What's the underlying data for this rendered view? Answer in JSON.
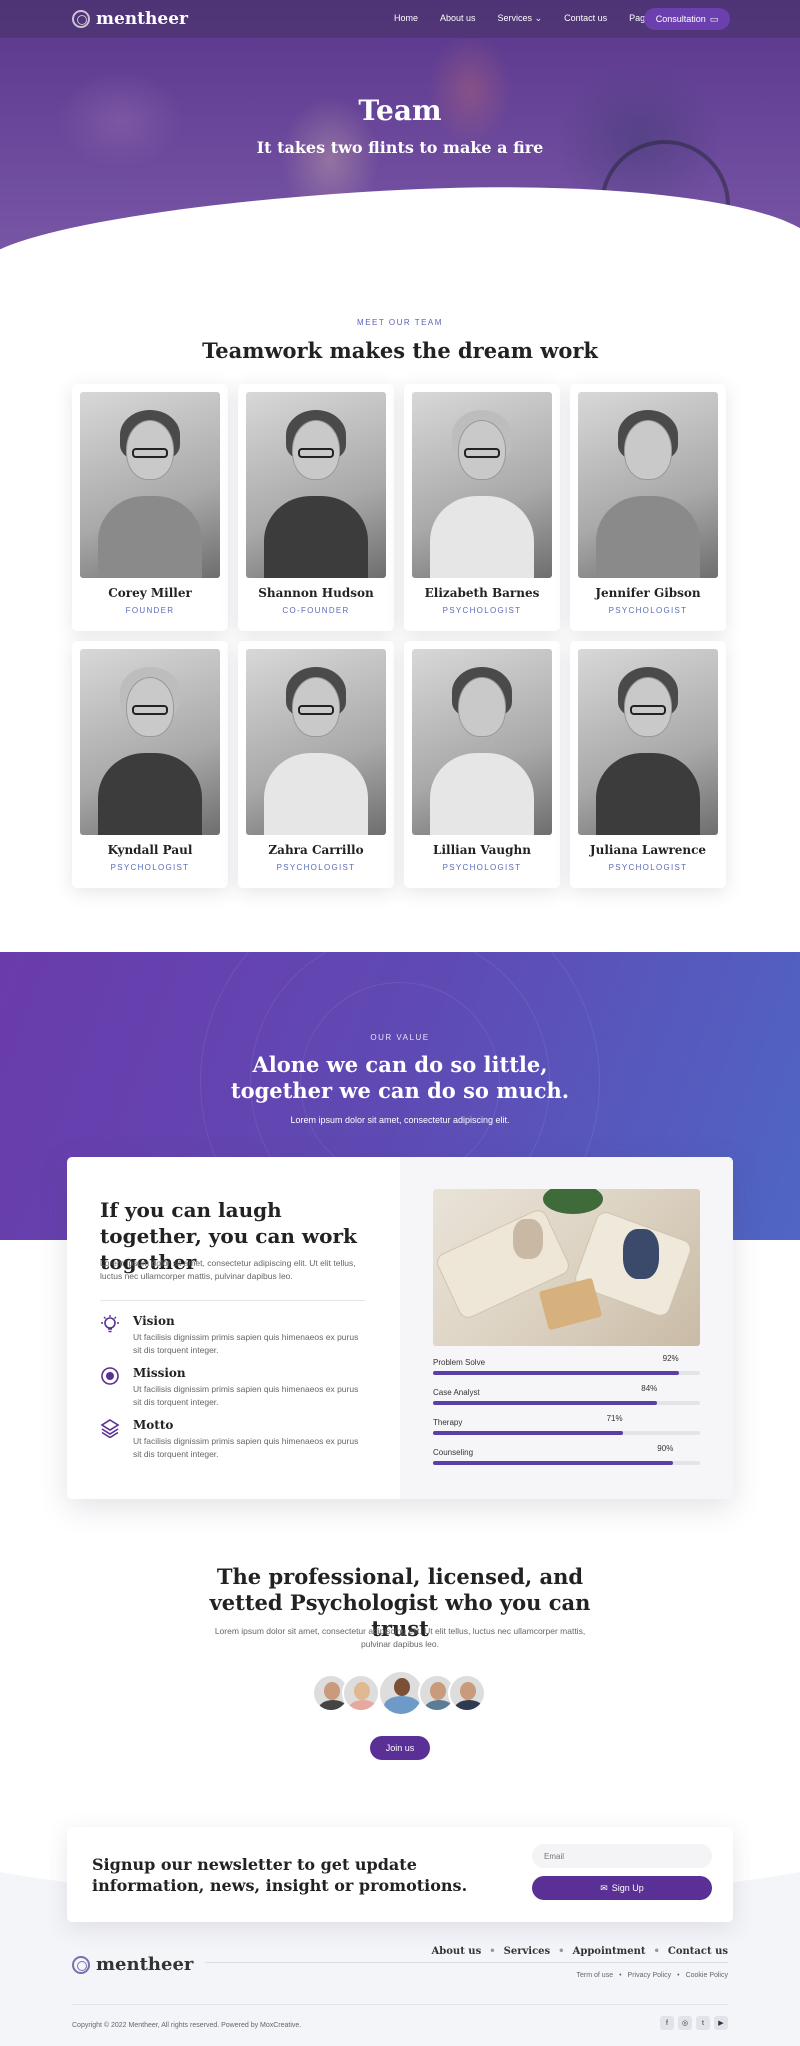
{
  "brand": {
    "name": "mentheer"
  },
  "nav": {
    "links": [
      "Home",
      "About us",
      "Services",
      "Contact us",
      "Pages"
    ],
    "consultation": "Consultation"
  },
  "hero": {
    "title": "Team",
    "subtitle": "It takes two flints to make a fire"
  },
  "team": {
    "eyebrow": "MEET OUR TEAM",
    "title": "Teamwork makes the dream work",
    "members": [
      {
        "name": "Corey Miller",
        "role": "FOUNDER"
      },
      {
        "name": "Shannon Hudson",
        "role": "CO-FOUNDER"
      },
      {
        "name": "Elizabeth Barnes",
        "role": "PSYCHOLOGIST"
      },
      {
        "name": "Jennifer Gibson",
        "role": "PSYCHOLOGIST"
      },
      {
        "name": "Kyndall Paul",
        "role": "PSYCHOLOGIST"
      },
      {
        "name": "Zahra Carrillo",
        "role": "PSYCHOLOGIST"
      },
      {
        "name": "Lillian Vaughn",
        "role": "PSYCHOLOGIST"
      },
      {
        "name": "Juliana Lawrence",
        "role": "PSYCHOLOGIST"
      }
    ]
  },
  "value": {
    "eyebrow": "OUR VALUE",
    "title": "Alone we can do so little, together we can do so much.",
    "subtitle": "Lorem ipsum dolor sit amet, consectetur adipiscing elit.",
    "card_title": "If you can laugh together, you can work together",
    "card_text": "Lorem ipsum dolor sit amet, consectetur adipiscing elit. Ut elit tellus, luctus nec ullamcorper mattis, pulvinar dapibus leo.",
    "features": [
      {
        "title": "Vision",
        "text": "Ut facilisis dignissim primis sapien quis himenaeos ex purus sit dis torquent integer.",
        "icon": "lightbulb-icon"
      },
      {
        "title": "Mission",
        "text": "Ut facilisis dignissim primis sapien quis himenaeos ex purus sit dis torquent integer.",
        "icon": "target-icon"
      },
      {
        "title": "Motto",
        "text": "Ut facilisis dignissim primis sapien quis himenaeos ex purus sit dis torquent integer.",
        "icon": "layers-icon"
      }
    ],
    "skills": [
      {
        "label": "Problem Solve",
        "pct": "92%",
        "value": 92
      },
      {
        "label": "Case Analyst",
        "pct": "84%",
        "value": 84
      },
      {
        "label": "Therapy",
        "pct": "71%",
        "value": 71
      },
      {
        "label": "Counseling",
        "pct": "90%",
        "value": 90
      }
    ]
  },
  "pro": {
    "title": "The professional, licensed, and vetted Psychologist who you can trust",
    "text": "Lorem ipsum dolor sit amet, consectetur adipiscing elit. Ut elit tellus, luctus nec ullamcorper mattis, pulvinar dapibus leo.",
    "join": "Join us"
  },
  "newsletter": {
    "title": "Signup our newsletter to get update information, news, insight or promotions.",
    "placeholder": "Email",
    "button": "Sign Up"
  },
  "footer": {
    "links": [
      "About us",
      "Services",
      "Appointment",
      "Contact us"
    ],
    "legal": [
      "Term of use",
      "Privacy Policy",
      "Cookie Policy"
    ],
    "copyright": "Copyright © 2022 Mentheer, All rights reserved. Powered by MoxCreative.",
    "socials": [
      "f",
      "◎",
      "t",
      "▶"
    ]
  },
  "colors": {
    "primary": "#5a2f96",
    "accent": "#5b6cb8",
    "band_start": "#6a3bab",
    "band_end": "#4f66c4"
  }
}
